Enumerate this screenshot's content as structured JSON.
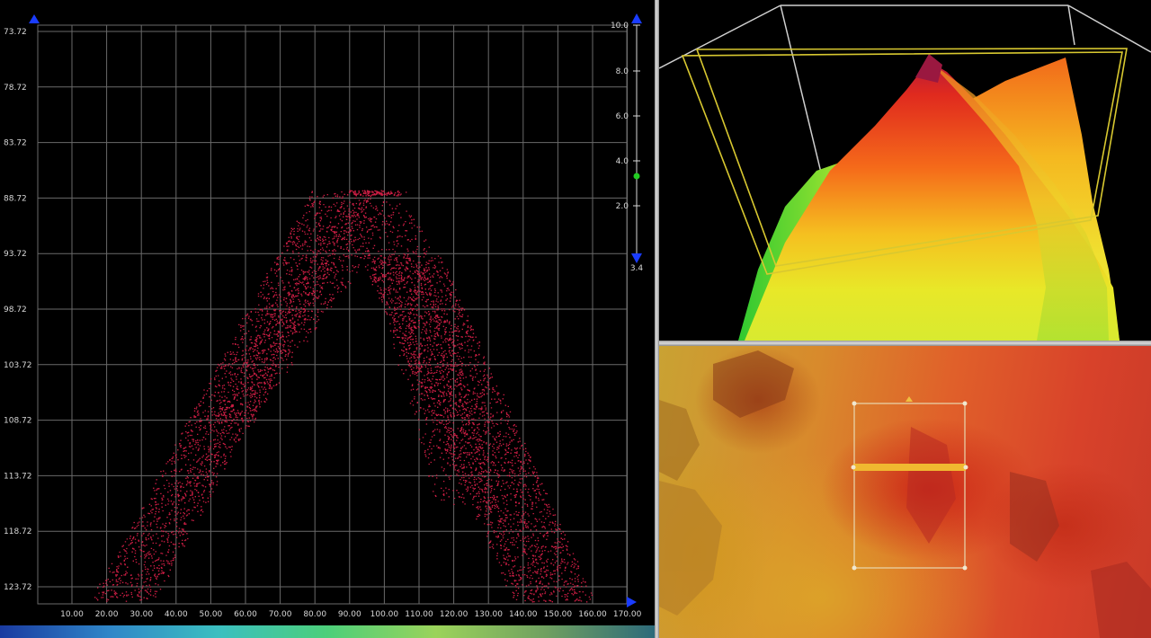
{
  "profile_view": {
    "y_ticks": [
      "73.72",
      "78.72",
      "83.72",
      "88.72",
      "93.72",
      "98.72",
      "103.72",
      "108.72",
      "113.72",
      "118.72",
      "123.72"
    ],
    "x_ticks": [
      "10.00",
      "20.00",
      "30.00",
      "40.00",
      "50.00",
      "60.00",
      "70.00",
      "80.00",
      "90.00",
      "100.00",
      "110.00",
      "120.00",
      "130.00",
      "140.00",
      "150.00",
      "160.00",
      "170.00"
    ],
    "point_color": "#e0204a"
  },
  "depth_scale": {
    "ticks": [
      "10.0",
      "8.0",
      "6.0",
      "4.0",
      "2.0"
    ],
    "current_value": "3.4",
    "marker_color": "#22cc22",
    "arrow_color": "#1a3cff"
  },
  "view_3d": {
    "colors": {
      "peak": "#c81e3c",
      "mid": "#ff7a1a",
      "low": "#f5e020",
      "base": "#38d030",
      "box": "#d8c830"
    }
  },
  "map_view": {
    "selection_color": "#e8d8b0",
    "profile_line_color": "#f0b830"
  }
}
